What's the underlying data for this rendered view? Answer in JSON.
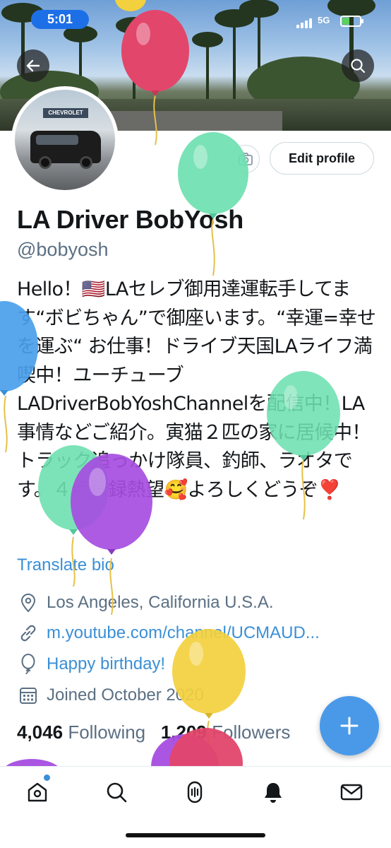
{
  "status_bar": {
    "time": "5:01",
    "network": "5G",
    "battery_level": 0.4
  },
  "header": {
    "back_icon": "arrow-left-icon",
    "search_icon": "search-icon"
  },
  "avatar": {
    "sign_text": "CHEVROLET"
  },
  "actions": {
    "camera_icon": "camera-icon",
    "edit_profile_label": "Edit profile"
  },
  "profile": {
    "name": "LA Driver BobYosh",
    "handle": "@bobyosh",
    "bio": "Hello！🇺🇸LAセレブ御用達運転手してます“ボビちゃん”で御座います。“幸運=幸せを運ぶ“ お仕事！ドライブ天国LAライフ満喫中！ユーチューブLADriverBobYoshChannelを配信中！LA事情などご紹介。寅猫２匹の家に居候中！トラック追っかけ隊員、釣師、ラオタです。４点登録熱望🥰よろしくどうぞ❣️",
    "translate_label": "Translate bio",
    "location": "Los Angeles, California U.S.A.",
    "website": "m.youtube.com/channel/UCMAUD...",
    "birthday": "Happy birthday!",
    "joined": "Joined October 2020",
    "following_count": "4,046",
    "following_label": "Following",
    "followers_count": "1,209",
    "followers_label": "Followers"
  },
  "colors": {
    "accent": "#3a8fd6",
    "fab": "#4a99e9",
    "secondary_text": "#5b7083"
  },
  "tabbar": {
    "items": [
      "home-icon",
      "search-icon",
      "spaces-icon",
      "notifications-icon",
      "messages-icon"
    ]
  }
}
